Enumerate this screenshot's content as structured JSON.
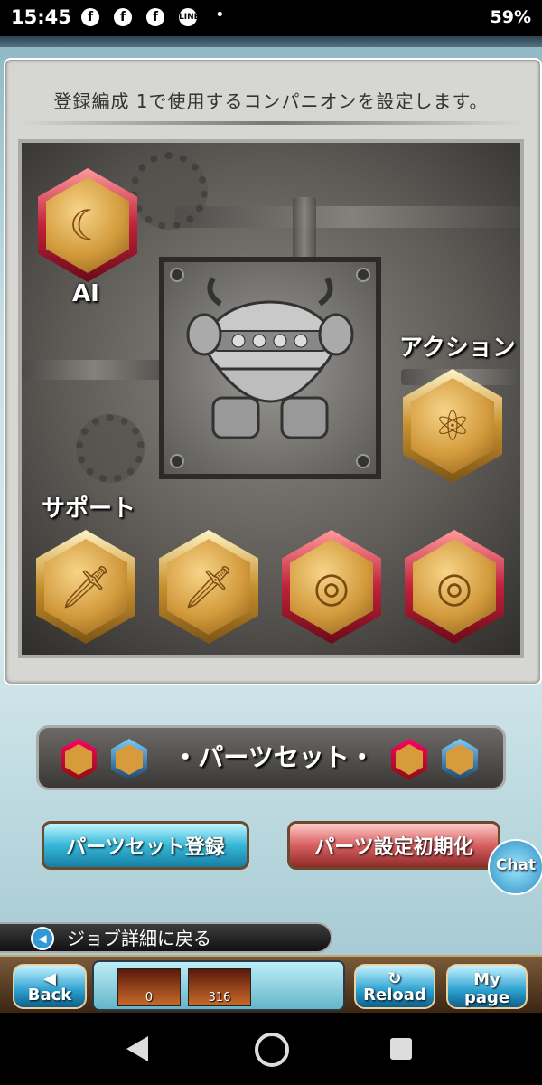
{
  "status_bar": {
    "time": "15:45",
    "notification_icons": [
      "facebook-icon",
      "facebook-icon",
      "facebook-icon",
      "line-icon"
    ],
    "battery": "59%"
  },
  "screen": {
    "message": "登録編成 1で使用するコンパニオンを設定します。",
    "labels": {
      "ai": "AI",
      "action": "アクション",
      "support": "サポート"
    },
    "parts_set_title": "・パーツセット・",
    "register_button": "パーツセット登録",
    "reset_button": "パーツ設定初期化",
    "chat_button": "Chat",
    "back_link": "ジョブ詳細に戻る"
  },
  "bottom_nav": {
    "back": "Back",
    "reload": "Reload",
    "mypage": "My page",
    "items": [
      {
        "name": "item-1",
        "count": "0"
      },
      {
        "name": "item-2",
        "count": "316"
      }
    ]
  },
  "colors": {
    "gold": "#d29a3c",
    "red": "#c0223a",
    "blue": "#2aa0cf"
  }
}
